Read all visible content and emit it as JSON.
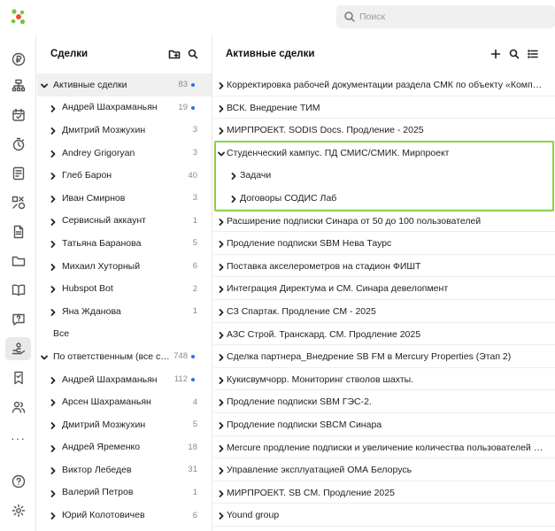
{
  "search": {
    "placeholder": "Поиск"
  },
  "colors": {
    "accent_logo": "#7ac143",
    "highlight": "#8bd14a",
    "badge_dot": "#2f6fe0"
  },
  "rail": {
    "icons": [
      "currency-icon",
      "org-structure-icon",
      "calendar-icon",
      "timer-icon",
      "checklist-icon",
      "shapes-icon",
      "document-icon",
      "folder-icon",
      "book-icon",
      "chat-question-icon",
      "deals-icon",
      "bookmark-icon",
      "users-icon",
      "more-icon",
      "help-icon",
      "settings-icon"
    ],
    "active": "deals-icon"
  },
  "left_panel": {
    "title": "Сделки",
    "rows": [
      {
        "label": "Активные сделки",
        "count": "83",
        "dot": true,
        "level": 0,
        "expanded": true,
        "selected": true
      },
      {
        "label": "Андрей Шахраманьян",
        "count": "19",
        "dot": true,
        "level": 1
      },
      {
        "label": "Дмитрий Мозжухин",
        "count": "3",
        "level": 1
      },
      {
        "label": "Andrey Grigoryan",
        "count": "3",
        "level": 1
      },
      {
        "label": "Глеб Барон",
        "count": "40",
        "level": 1
      },
      {
        "label": "Иван Смирнов",
        "count": "3",
        "level": 1
      },
      {
        "label": "Сервисный аккаунт",
        "count": "1",
        "level": 1
      },
      {
        "label": "Татьяна Баранова",
        "count": "5",
        "level": 1
      },
      {
        "label": "Михаил Хуторный",
        "count": "6",
        "level": 1
      },
      {
        "label": "Hubspot Bot",
        "count": "2",
        "level": 1
      },
      {
        "label": "Яна Жданова",
        "count": "1",
        "level": 1
      },
      {
        "label": "Все",
        "count": "",
        "level": "plain"
      },
      {
        "label": "По ответственным (все сде...",
        "count": "748",
        "dot": true,
        "level": 0,
        "expanded": true
      },
      {
        "label": "Андрей Шахраманьян",
        "count": "112",
        "dot": true,
        "level": 1
      },
      {
        "label": "Арсен Шахраманьян",
        "count": "4",
        "level": 1
      },
      {
        "label": "Дмитрий Мозжухин",
        "count": "5",
        "level": 1
      },
      {
        "label": "Андрей Яременко",
        "count": "18",
        "level": 1
      },
      {
        "label": "Виктор Лебедев",
        "count": "31",
        "level": 1
      },
      {
        "label": "Валерий Петров",
        "count": "1",
        "level": 1
      },
      {
        "label": "Юрий Колотовичев",
        "count": "6",
        "level": 1
      }
    ]
  },
  "main_panel": {
    "title": "Активные сделки",
    "rows": [
      {
        "label": "Корректировка рабочей документации раздела СМК по объекту «Комплекс..."
      },
      {
        "label": "ВСК. Внедрение ТИМ"
      },
      {
        "label": "МИРПРОЕКТ. SODIS Docs. Продление - 2025"
      },
      {
        "label": "Студенческий кампус. ПД СМИС/СМИК. Мирпроект",
        "expanded": true
      },
      {
        "label": "Задачи",
        "sub": true
      },
      {
        "label": "Договоры СОДИС Лаб",
        "sub": true
      },
      {
        "label": "Расширение подписки Синара от 50 до 100 пользователей"
      },
      {
        "label": "Продление подписки SBM Нева Таурс"
      },
      {
        "label": "Поставка акселерометров на стадион ФИШТ"
      },
      {
        "label": "Интеграция Директума и СМ. Синара девелопмент"
      },
      {
        "label": "СЗ Спартак. Продление СМ - 2025"
      },
      {
        "label": "АЗС Строй. Транскард. СМ. Продление 2025"
      },
      {
        "label": "Сделка партнера_Внедрение SB FM в Mercury Properties (Этап 2)"
      },
      {
        "label": "Кукисвумчорр. Мониторинг стволов шахты."
      },
      {
        "label": "Продление подписки SBM ГЭС-2."
      },
      {
        "label": "Продление подписки SBCM Синара"
      },
      {
        "label": "Mercure продление подписки и увеличение количества пользователей до 1..."
      },
      {
        "label": "Управление эксплуатацией ОМА Белорусь"
      },
      {
        "label": "МИРПРОЕКТ. SB CM. Продление 2025"
      },
      {
        "label": "Yound group"
      }
    ]
  }
}
